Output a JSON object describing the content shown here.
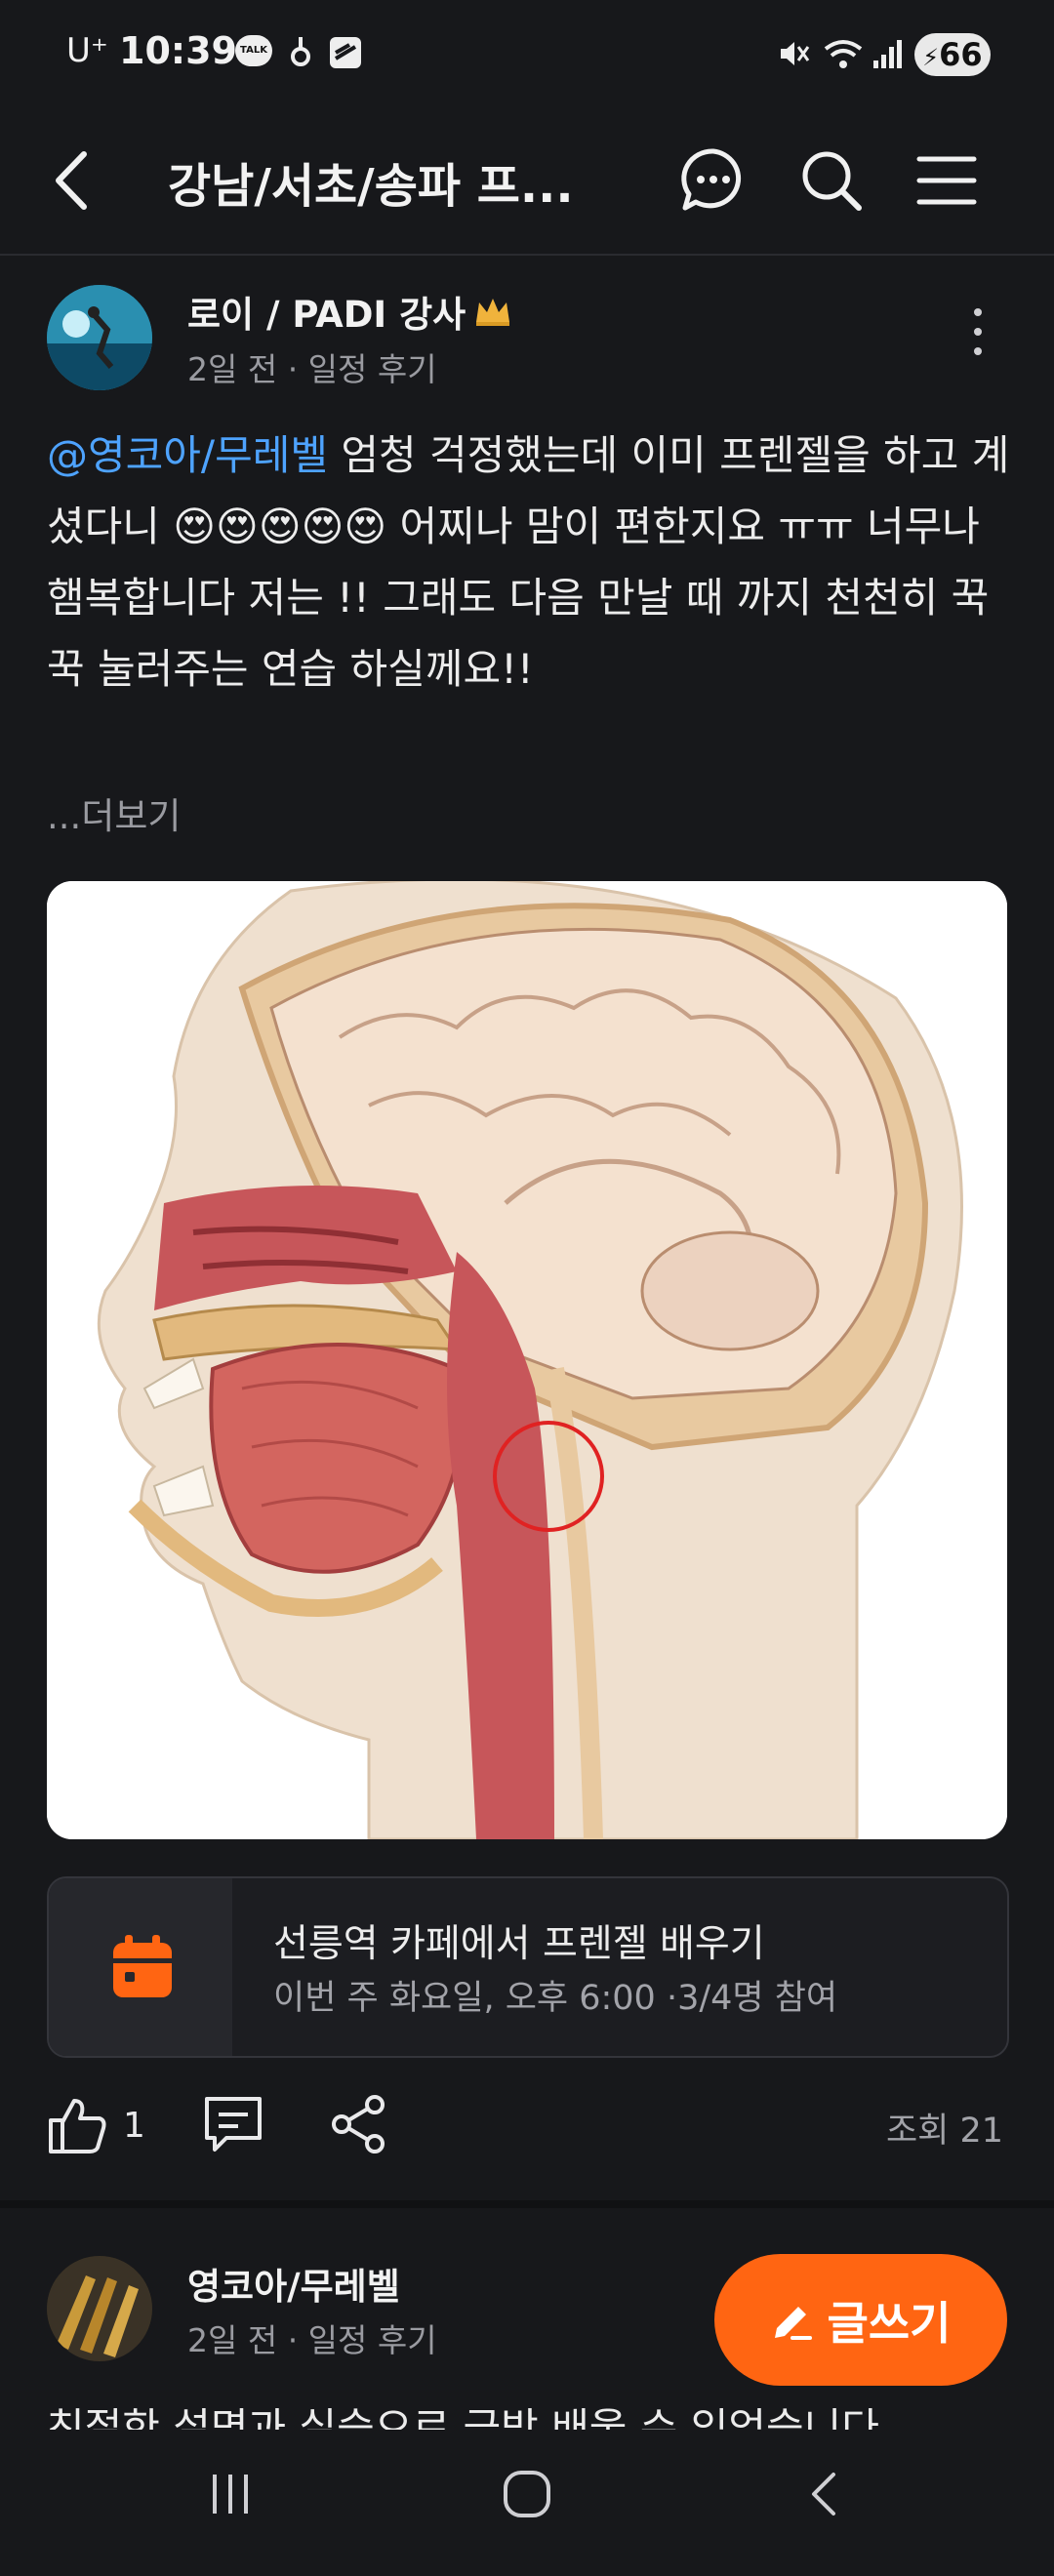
{
  "status_bar": {
    "carrier": "U⁺",
    "time": "10:39",
    "talk_badge": "TALK",
    "battery": "66"
  },
  "header": {
    "title": "강남/서초/송파 프..."
  },
  "post": {
    "author": "로이 / PADI 강사",
    "meta": "2일 전 · 일정 후기",
    "mention": "@영코아/무레벨",
    "body": " 엄청 걱정했는데 이미 프렌젤을 하고 계셨다니 😍😍😍😍😍 어찌나 맘이 편한지요 ㅠㅠ 너무나 햄복합니다 저는 !! 그래도 다음 만날 때 까지 천천히 꾹 꾹 눌러주는 연습 하실께요!!",
    "more": "...더보기",
    "event": {
      "title": "선릉역 카페에서 프렌젤 배우기",
      "subtitle": "이번 주 화요일, 오후 6:00 ·3/4명 참여"
    },
    "like_count": "1",
    "views": "조회 21"
  },
  "next_post": {
    "author": "영코아/무레벨",
    "meta": "2일 전 · 일정 후기",
    "body_preview": "친절한 설명과 실습으로 금방 배울 수 있었습니다"
  },
  "fab": {
    "label": "글쓰기"
  },
  "colors": {
    "accent": "#ff6512",
    "mention": "#4ea3ff",
    "background": "#17181b"
  }
}
